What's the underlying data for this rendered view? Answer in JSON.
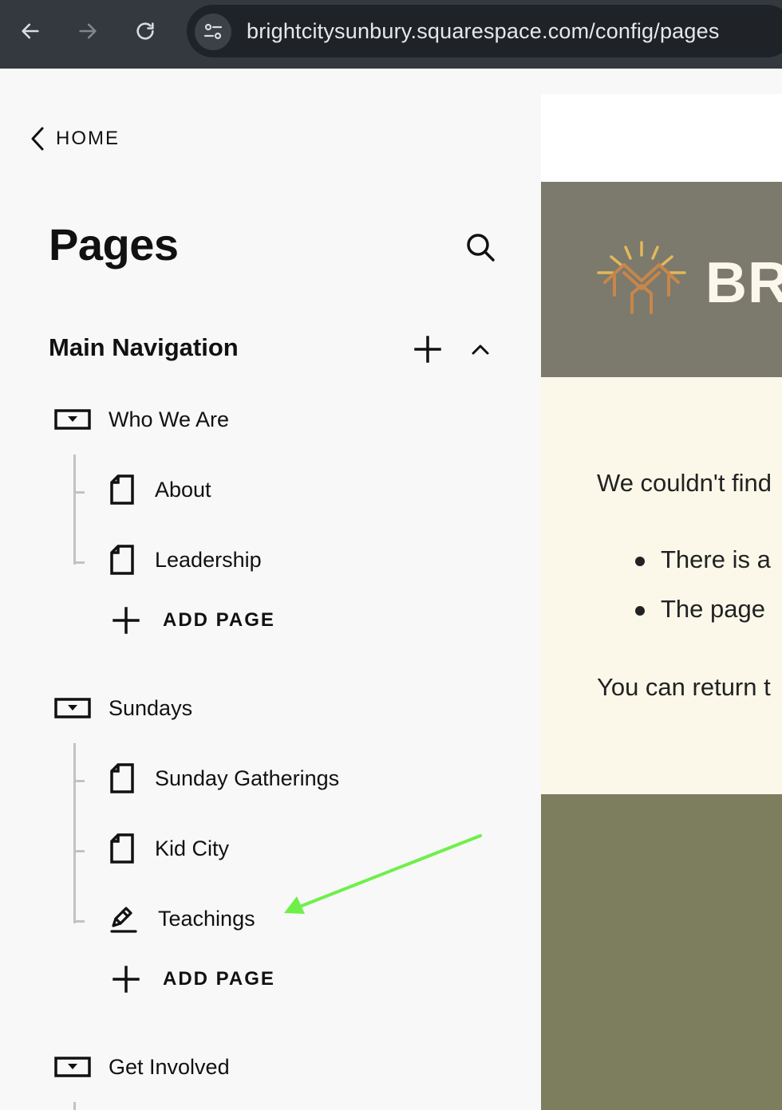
{
  "browser": {
    "url": "brightcitysunbury.squarespace.com/config/pages"
  },
  "sidebar": {
    "home_label": "HOME",
    "title": "Pages",
    "section_title": "Main Navigation",
    "folders": [
      {
        "label": "Who We Are",
        "pages": [
          {
            "label": "About",
            "icon": "page-icon"
          },
          {
            "label": "Leadership",
            "icon": "page-icon"
          }
        ],
        "add_label": "ADD PAGE"
      },
      {
        "label": "Sundays",
        "pages": [
          {
            "label": "Sunday Gatherings",
            "icon": "page-icon"
          },
          {
            "label": "Kid City",
            "icon": "page-icon"
          },
          {
            "label": "Teachings",
            "icon": "blog-icon"
          }
        ],
        "add_label": "ADD PAGE"
      },
      {
        "label": "Get Involved",
        "pages": []
      }
    ]
  },
  "preview": {
    "logo_text": "BR",
    "message": "We couldn't find",
    "bullets": [
      "There is a",
      "The page"
    ],
    "footer_text": "You can return t"
  },
  "colors": {
    "browser_bar": "#34393f",
    "url_bar": "#1f2328",
    "sidebar_bg": "#f8f8f8",
    "preview_header": "#7b7a6c",
    "preview_body": "#fbf8ea",
    "preview_footer": "#7c7e5d",
    "logo_accent": "#c8864a",
    "annotation_arrow": "#6ef04a"
  }
}
